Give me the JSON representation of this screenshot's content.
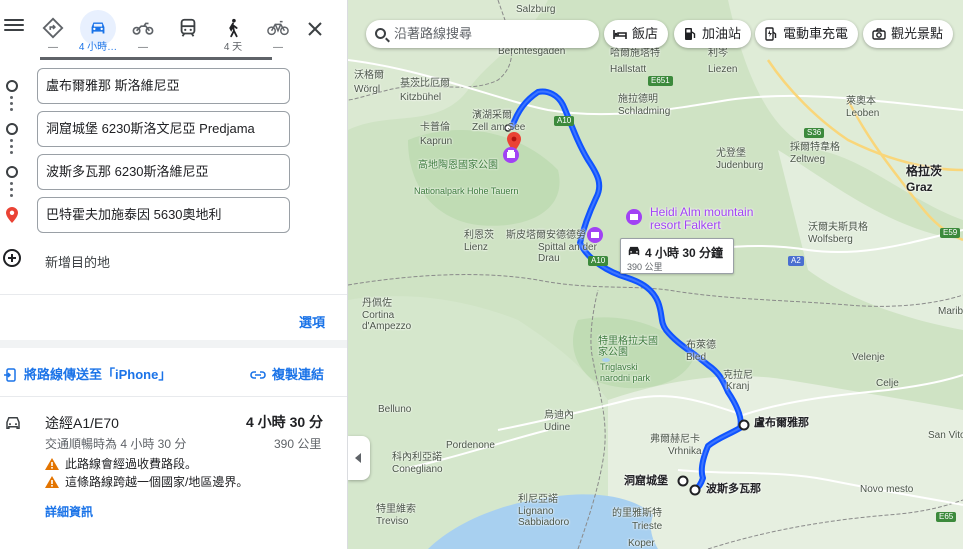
{
  "modes": {
    "best": {
      "label": "—"
    },
    "drive": {
      "label": "4 小時…"
    },
    "moto": {
      "label": "—"
    },
    "transit": {
      "label": ""
    },
    "walk": {
      "label": "4 天"
    },
    "bike": {
      "label": "—"
    }
  },
  "stops": [
    {
      "value": "盧布爾雅那 斯洛維尼亞"
    },
    {
      "value": "洞窟城堡 6230斯洛文尼亞 Predjama"
    },
    {
      "value": "波斯多瓦那 6230斯洛維尼亞"
    },
    {
      "value": "巴特霍夫加施泰因 5630奧地利"
    }
  ],
  "add_destination": "新增目的地",
  "options_label": "選項",
  "share": {
    "send_label": "將路線傳送至「iPhone」",
    "copy_label": "複製連結"
  },
  "route": {
    "via": "途經A1/E70",
    "time": "4 小時 30 分",
    "traffic": "交通順暢時為 4 小時 30 分",
    "distance": "390 公里",
    "warnings": [
      "此路線會經過收費路段。",
      "這條路線跨越一個國家/地區邊界。"
    ],
    "details_label": "詳細資訊"
  },
  "map": {
    "search_placeholder": "沿著路線搜尋",
    "chips": [
      "飯店",
      "加油站",
      "電動車充電",
      "觀光景點"
    ],
    "route_callout": {
      "time": "4 小時 30 分鐘",
      "distance": "390 公里"
    },
    "labels": {
      "salzburg": "Salzburg",
      "berchtesgaden": "Berchtesgaden",
      "hallstatt_zh": "哈爾施塔特",
      "hallstatt": "Hallstatt",
      "liezen_zh": "利岑",
      "liezen": "Liezen",
      "kitzbuhel_zh": "基茨比厄爾",
      "kitzbuhel": "Kitzbühel",
      "worgl_zh": "沃格爾",
      "worgl": "Wörgl",
      "zellamsee_zh": "濱湖采爾",
      "zellamsee": "Zell am See",
      "kaprun_zh": "卡普倫",
      "kaprun": "Kaprun",
      "schladming_zh": "施拉德明",
      "schladming": "Schladming",
      "leoben_zh": "萊奧本",
      "leoben": "Leoben",
      "judenburg_zh": "尤登堡",
      "judenburg": "Judenburg",
      "zeltweg_zh": "採爾特韋格",
      "zeltweg": "Zeltweg",
      "graz_zh": "格拉茨",
      "graz": "Graz",
      "hohetauern_zh": "高地陶恩國家公園",
      "hohetauern": "Nationalpark Hohe Tauern",
      "lienz_zh": "利恩茨",
      "lienz": "Lienz",
      "spittal_zh": "斯皮塔爾安德德勞",
      "spittal": "Spittal an der Drau",
      "heidi": "Heidi Alm mountain resort Falkert",
      "wolfsberg_zh": "沃爾夫斯貝格",
      "wolfsberg": "Wolfsberg",
      "cortina_zh": "丹佩佐",
      "cortina": "Cortina d'Ampezzo",
      "triglav_zh": "特里格拉夫國家公園",
      "triglav": "Triglavski narodni park",
      "bled_zh": "布萊德",
      "bled": "Bled",
      "kranj_zh": "克拉尼",
      "kranj": "Kranj",
      "velenje": "Velenje",
      "celje": "Celje",
      "maribor": "Maribor",
      "ljubljana": "盧布爾雅那",
      "belluno": "Belluno",
      "udine_zh": "烏迪內",
      "udine": "Udine",
      "pordenone": "Pordenone",
      "conegliano_zh": "科內利亞諾",
      "conegliano": "Conegliano",
      "treviso_zh": "特里維索",
      "treviso": "Treviso",
      "lignano_zh": "利尼亞諾",
      "lignano": "Lignano Sabbiadoro",
      "trieste_zh": "的里雅斯特",
      "trieste": "Trieste",
      "vrhnika_zh": "弗爾赫尼卡",
      "vrhnika": "Vrhnika",
      "predjama": "洞窟城堡",
      "postojna": "波斯多瓦那",
      "novomesto": "Novo mesto",
      "koper": "Koper",
      "sanvito": "San Vito"
    },
    "shields": [
      "E651",
      "S36",
      "E59",
      "A2",
      "A10",
      "A10",
      "E65"
    ]
  }
}
